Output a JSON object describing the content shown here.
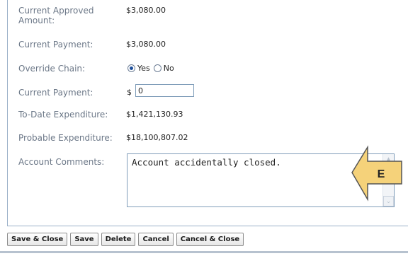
{
  "form": {
    "current_approved_amount_label": "Current Approved Amount:",
    "current_approved_amount_value": "$3,080.00",
    "current_payment_label": "Current Payment:",
    "current_payment_value": "$3,080.00",
    "override_chain_label": "Override Chain:",
    "override_chain_yes": "Yes",
    "override_chain_no": "No",
    "override_chain_selected": "Yes",
    "current_payment_input_label": "Current Payment:",
    "currency_symbol": "$",
    "current_payment_input_value": "0",
    "to_date_expenditure_label": "To-Date Expenditure:",
    "to_date_expenditure_value": "$1,421,130.93",
    "probable_expenditure_label": "Probable Expenditure:",
    "probable_expenditure_value": "$18,100,807.02",
    "account_comments_label": "Account Comments:",
    "account_comments_value": "Account accidentally closed."
  },
  "callout": {
    "letter": "E",
    "fill_color": "#f5d27a",
    "stroke_color": "#555555"
  },
  "buttons": {
    "save_close": "Save & Close",
    "save": "Save",
    "delete": "Delete",
    "cancel": "Cancel",
    "cancel_close": "Cancel & Close"
  },
  "colors": {
    "label_text": "#6b7787",
    "panel_border": "#9ab0c8",
    "radio_dot": "#1e4f9c"
  }
}
